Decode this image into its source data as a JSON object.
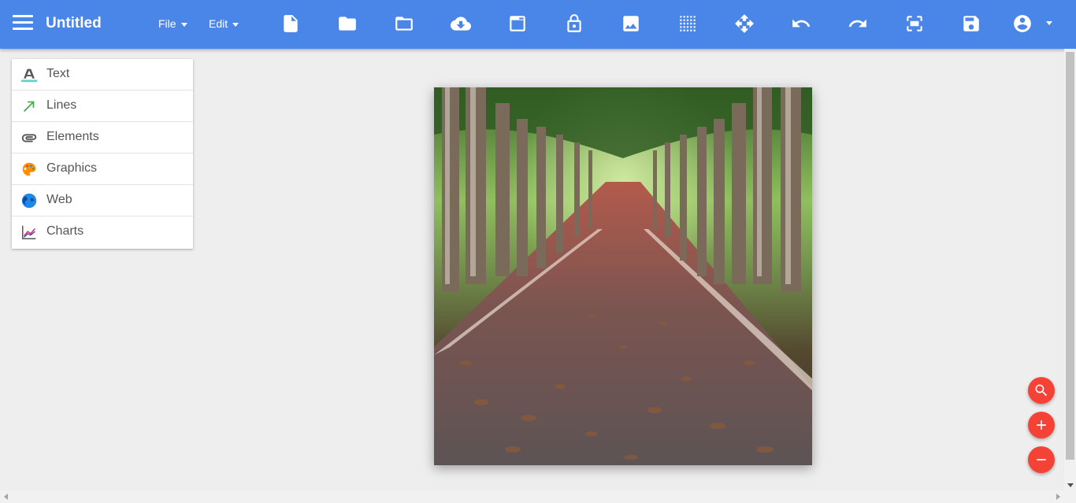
{
  "header": {
    "title": "Untitled",
    "menus": {
      "file": "File",
      "edit": "Edit"
    },
    "toolbar_icons": [
      "new-file-icon",
      "open-folder-icon",
      "folder-icon",
      "cloud-download-icon",
      "window-icon",
      "lock-icon",
      "image-icon",
      "grid-icon",
      "move-icon",
      "undo-icon",
      "redo-icon",
      "fullscreen-icon",
      "save-icon",
      "account-icon"
    ],
    "accent": "#4a86e8"
  },
  "sidebar": {
    "items": [
      {
        "label": "Text",
        "icon": "text-icon"
      },
      {
        "label": "Lines",
        "icon": "line-arrow-icon"
      },
      {
        "label": "Elements",
        "icon": "paperclip-icon"
      },
      {
        "label": "Graphics",
        "icon": "palette-icon"
      },
      {
        "label": "Web",
        "icon": "globe-icon"
      },
      {
        "label": "Charts",
        "icon": "line-chart-icon"
      }
    ]
  },
  "canvas": {
    "image": "tree-lined road with fallen leaves"
  },
  "zoom_controls": [
    "search-icon",
    "zoom-in-icon",
    "zoom-out-icon"
  ],
  "fab_color": "#f44336"
}
